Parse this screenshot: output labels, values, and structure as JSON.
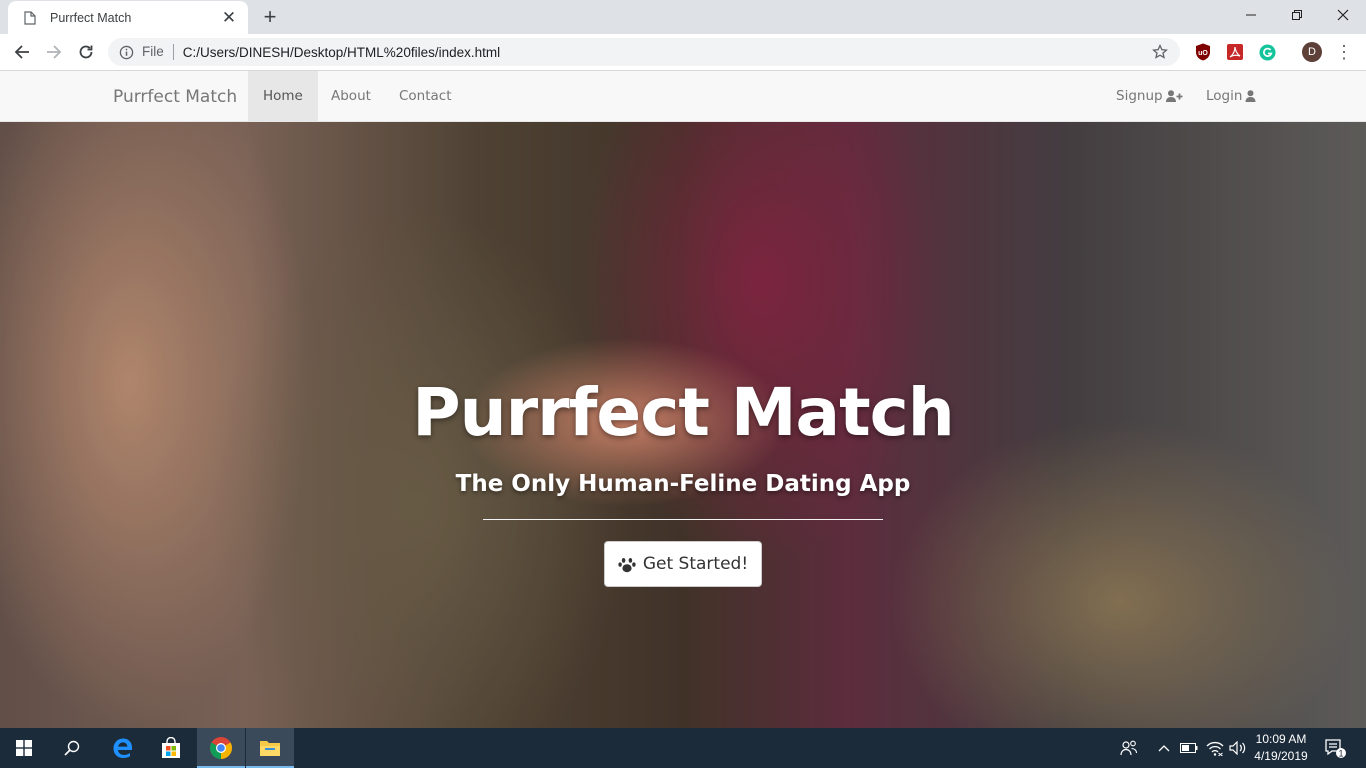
{
  "browser": {
    "tab_title": "Purrfect Match",
    "tab_close_glyph": "✕",
    "new_tab_glyph": "+",
    "url_scheme": "File",
    "url": "C:/Users/DINESH/Desktop/HTML%20files/index.html",
    "profile_initial": "D",
    "menu_glyph": "⋮",
    "extensions": [
      "ublock-origin-icon",
      "pdf-extension-icon",
      "grammarly-icon"
    ]
  },
  "site": {
    "brand": "Purrfect Match",
    "nav": [
      {
        "label": "Home",
        "active": true
      },
      {
        "label": "About",
        "active": false
      },
      {
        "label": "Contact",
        "active": false
      }
    ],
    "nav_right": {
      "signup": "Signup",
      "login": "Login"
    }
  },
  "hero": {
    "title": "Purrfect Match",
    "subtitle": "The Only Human-Feline Dating App",
    "cta_label": "Get Started!"
  },
  "taskbar": {
    "time": "10:09 AM",
    "date": "4/19/2019",
    "notification_count": "1"
  },
  "colors": {
    "navbar_bg": "#f8f8f8",
    "nav_active_bg": "#e7e7e7",
    "nav_text": "#777777",
    "taskbar_bg": "#1c2b3a"
  }
}
